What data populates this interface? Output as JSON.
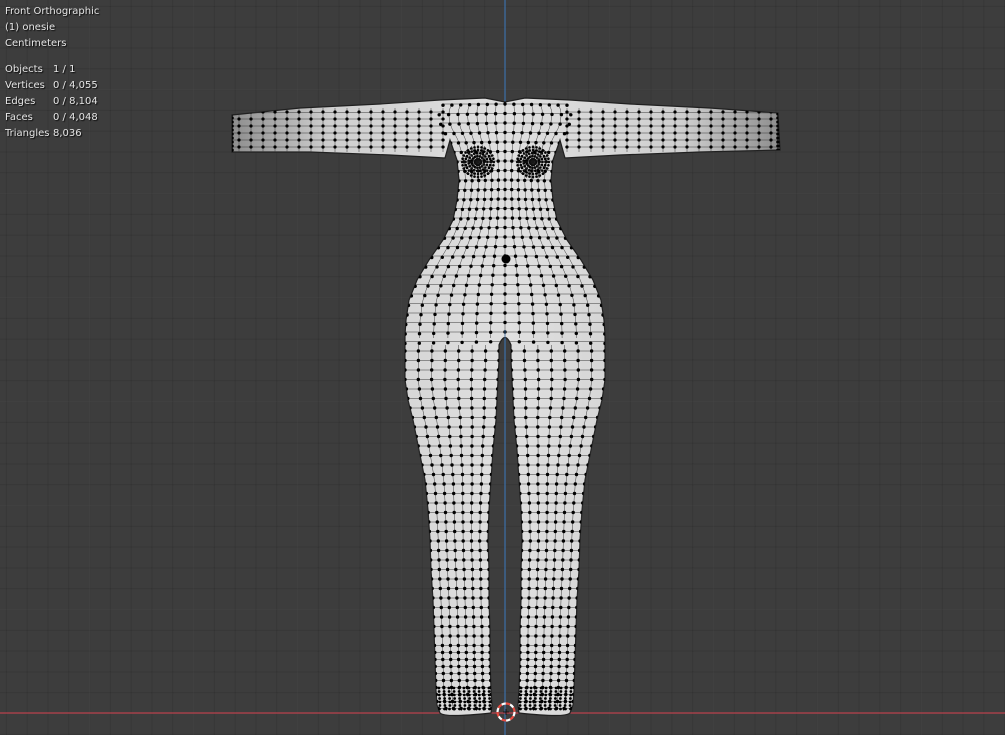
{
  "viewport": {
    "view_name": "Front Orthographic",
    "object_label": "(1) onesie",
    "units": "Centimeters",
    "stats": [
      {
        "label": "Objects",
        "value": "1 / 1"
      },
      {
        "label": "Vertices",
        "value": "0 / 4,055"
      },
      {
        "label": "Edges",
        "value": "0 / 8,104"
      },
      {
        "label": "Faces",
        "value": "0 / 4,048"
      },
      {
        "label": "Triangles",
        "value": "8,036"
      }
    ]
  },
  "colors": {
    "background": "#3d3d3d",
    "grid_line": "#444444",
    "x_axis": "#c4464f",
    "z_axis": "#3b6fa8",
    "mesh_fill": "#d4d4d4",
    "mesh_shade": "#9a9a9a",
    "wire": "#000000",
    "vertex": "#000000",
    "cursor_red": "#e84a3f",
    "cursor_white": "#ffffff"
  },
  "icons": {
    "origin_dot": "object-origin-icon",
    "cursor": "3d-cursor-icon"
  }
}
